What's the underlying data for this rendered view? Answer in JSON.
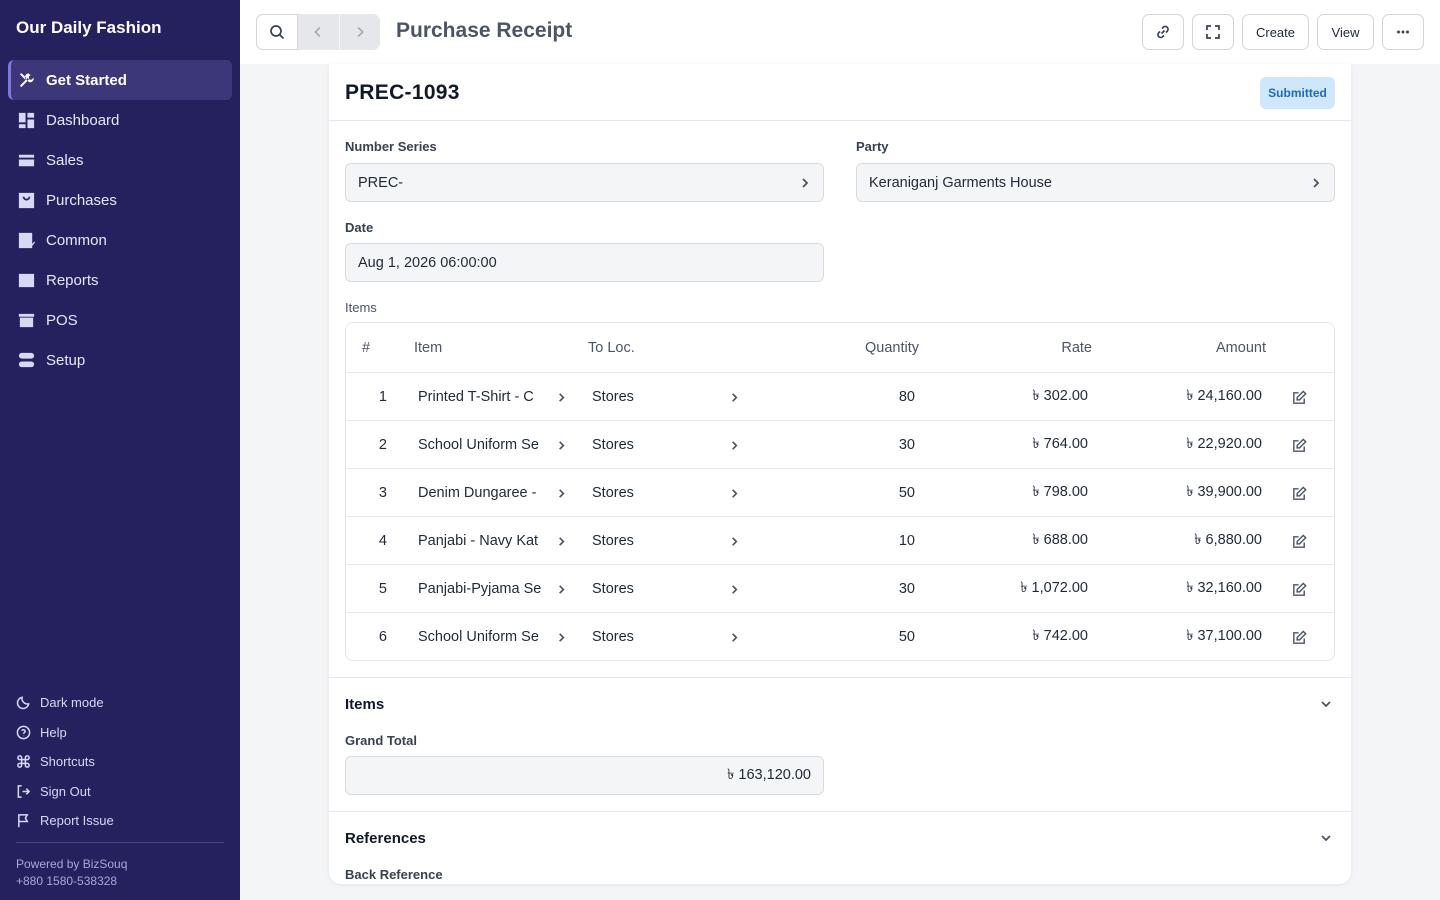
{
  "sidebar": {
    "brand": "Our Daily Fashion",
    "items": [
      {
        "label": "Get Started",
        "icon": "tools-icon"
      },
      {
        "label": "Dashboard",
        "icon": "dashboard-icon"
      },
      {
        "label": "Sales",
        "icon": "sales-icon"
      },
      {
        "label": "Purchases",
        "icon": "purchases-icon"
      },
      {
        "label": "Common",
        "icon": "common-icon"
      },
      {
        "label": "Reports",
        "icon": "reports-icon"
      },
      {
        "label": "POS",
        "icon": "pos-icon"
      },
      {
        "label": "Setup",
        "icon": "setup-icon"
      }
    ],
    "bottom": [
      {
        "label": "Dark mode",
        "icon": "moon-icon"
      },
      {
        "label": "Help",
        "icon": "help-icon"
      },
      {
        "label": "Shortcuts",
        "icon": "command-icon"
      },
      {
        "label": "Sign Out",
        "icon": "sign-out-icon"
      },
      {
        "label": "Report Issue",
        "icon": "flag-icon"
      }
    ],
    "powered_by": "Powered by BizSouq",
    "phone": "+880 1580-538328"
  },
  "topbar": {
    "title": "Purchase Receipt",
    "create_label": "Create",
    "view_label": "View"
  },
  "doc": {
    "name": "PREC-1093",
    "status": "Submitted",
    "number_series_label": "Number Series",
    "number_series": "PREC-",
    "party_label": "Party",
    "party": "Keraniganj Garments House",
    "date_label": "Date",
    "date": "Aug 1, 2026 06:00:00",
    "items_label": "Items"
  },
  "table": {
    "headers": {
      "num": "#",
      "item": "Item",
      "to_loc": "To Loc.",
      "quantity": "Quantity",
      "rate": "Rate",
      "amount": "Amount"
    },
    "rows": [
      {
        "num": "1",
        "item": "Printed T-Shirt - C",
        "to_loc": "Stores",
        "quantity": "80",
        "rate": "৳ 302.00",
        "amount": "৳ 24,160.00"
      },
      {
        "num": "2",
        "item": "School Uniform Se",
        "to_loc": "Stores",
        "quantity": "30",
        "rate": "৳ 764.00",
        "amount": "৳ 22,920.00"
      },
      {
        "num": "3",
        "item": "Denim Dungaree -",
        "to_loc": "Stores",
        "quantity": "50",
        "rate": "৳ 798.00",
        "amount": "৳ 39,900.00"
      },
      {
        "num": "4",
        "item": "Panjabi - Navy Kat",
        "to_loc": "Stores",
        "quantity": "10",
        "rate": "৳ 688.00",
        "amount": "৳ 6,880.00"
      },
      {
        "num": "5",
        "item": "Panjabi-Pyjama Se",
        "to_loc": "Stores",
        "quantity": "30",
        "rate": "৳ 1,072.00",
        "amount": "৳ 32,160.00"
      },
      {
        "num": "6",
        "item": "School Uniform Se",
        "to_loc": "Stores",
        "quantity": "50",
        "rate": "৳ 742.00",
        "amount": "৳ 37,100.00"
      }
    ]
  },
  "totals": {
    "section_title": "Items",
    "grand_total_label": "Grand Total",
    "grand_total": "৳ 163,120.00"
  },
  "references": {
    "section_title": "References",
    "back_reference_label": "Back Reference"
  }
}
